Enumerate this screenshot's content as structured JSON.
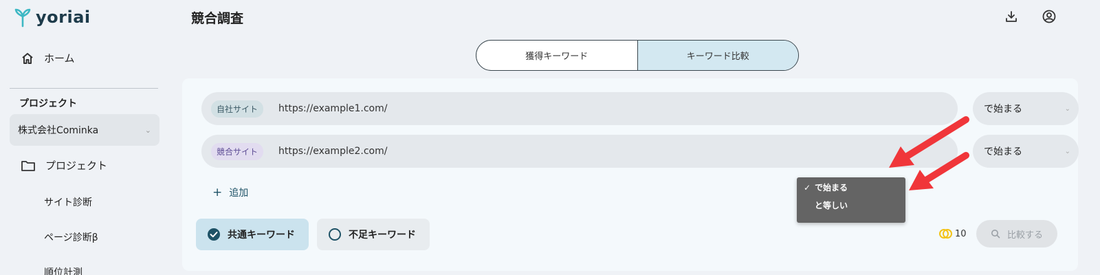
{
  "app": {
    "logo_text": "yoriai"
  },
  "sidebar": {
    "home_label": "ホーム",
    "section_title": "プロジェクト",
    "company": "株式会社Cominka",
    "project_label": "プロジェクト",
    "sub_items": [
      "サイト診断",
      "ページ診断β",
      "順位計測"
    ]
  },
  "header": {
    "title": "競合調査"
  },
  "tabs": [
    {
      "label": "獲得キーワード",
      "active": false
    },
    {
      "label": "キーワード比較",
      "active": true
    }
  ],
  "rows": [
    {
      "badge": "自社サイト",
      "url": "https://example1.com/",
      "match": "で始まる"
    },
    {
      "badge": "競合サイト",
      "url": "https://example2.com/",
      "match": "で始まる"
    }
  ],
  "add_label": "追加",
  "toggles": {
    "common": "共通キーワード",
    "missing": "不足キーワード"
  },
  "credits": "10",
  "compare_label": "比較する",
  "dropdown": {
    "options": [
      {
        "label": "で始まる",
        "checked": true
      },
      {
        "label": "と等しい",
        "checked": false
      }
    ]
  },
  "colors": {
    "accent": "#1e5266",
    "arrow": "#f0363a",
    "active_tab": "#d3e8f1",
    "credit_coin": "#f3c316"
  }
}
